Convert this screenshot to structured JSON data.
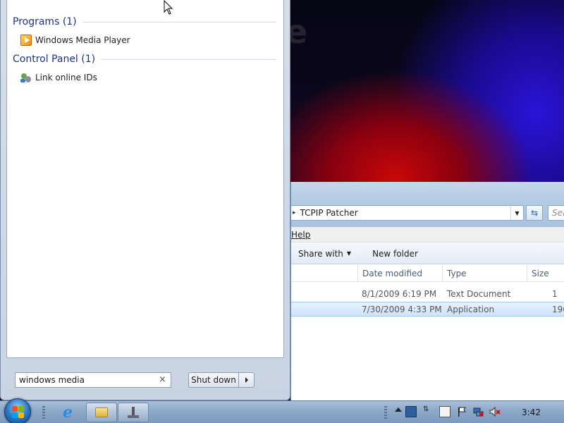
{
  "wallpaper": {
    "logo_text": "e"
  },
  "explorer": {
    "address": {
      "breadcrumb_sep": "▸",
      "path": "TCPIP Patcher",
      "search_placeholder": "Sea"
    },
    "menu": {
      "help": "Help"
    },
    "command_bar": {
      "share_with": "Share with",
      "new_folder": "New folder"
    },
    "columns": {
      "date_modified": "Date modified",
      "type": "Type",
      "size": "Size"
    },
    "files": [
      {
        "date": "8/1/2009 6:19 PM",
        "type": "Text Document",
        "size": "1",
        "selected": false
      },
      {
        "date": "7/30/2009 4:33 PM",
        "type": "Application",
        "size": "196",
        "selected": true
      }
    ]
  },
  "start_menu": {
    "groups": [
      {
        "label": "Programs (1)",
        "items": [
          {
            "label": "Windows Media Player",
            "icon": "windows-media-player-icon"
          }
        ]
      },
      {
        "label": "Control Panel (1)",
        "items": [
          {
            "label": "Link online IDs",
            "icon": "user-accounts-icon"
          }
        ]
      }
    ],
    "search": {
      "value": "windows media",
      "clear_glyph": "×"
    },
    "shutdown": {
      "label": "Shut down"
    }
  },
  "taskbar": {
    "pinned": [
      "internet-explorer-icon",
      "windows-explorer-icon",
      "tcpip-patcher-icon"
    ],
    "tray_icons": [
      "show-hidden-icons",
      "display-icon",
      "network-arrows-icon",
      "document-icon",
      "action-center-flag-icon",
      "network-icon",
      "volume-muted-icon"
    ],
    "clock": "3:42"
  }
}
